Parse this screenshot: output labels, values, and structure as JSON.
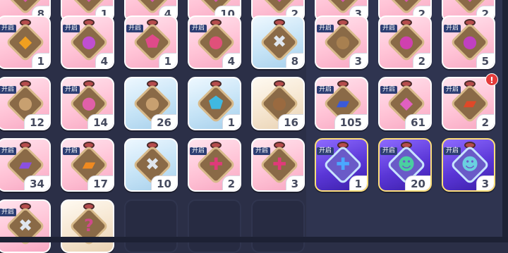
{
  "open_tag": "开启",
  "alert_glyph": "!",
  "rows": [
    [
      {
        "kind": "pink",
        "count": "8",
        "icon": "bag-icon",
        "glyph": "◆",
        "color": "#d45aa8",
        "tag": false
      },
      {
        "kind": "pink",
        "count": "1",
        "icon": "bag-icon",
        "glyph": "◆",
        "color": "#d45aa8",
        "tag": false
      },
      {
        "kind": "pink",
        "count": "4",
        "icon": "bag-icon",
        "glyph": "◆",
        "color": "#d45aa8",
        "tag": false
      },
      {
        "kind": "pink",
        "count": "10",
        "icon": "bag-icon",
        "glyph": "◆",
        "color": "#d45aa8",
        "tag": false
      },
      {
        "kind": "pink",
        "count": "2",
        "icon": "bag-icon",
        "glyph": "◆",
        "color": "#d45aa8",
        "tag": false
      },
      {
        "kind": "pink",
        "count": "3",
        "icon": "bag-icon",
        "glyph": "◆",
        "color": "#d45aa8",
        "tag": false
      },
      {
        "kind": "pink",
        "count": "2",
        "icon": "bag-icon",
        "glyph": "◆",
        "color": "#d45aa8",
        "tag": false
      },
      {
        "kind": "pink",
        "count": "2",
        "icon": "bag-icon",
        "glyph": "◆",
        "color": "#d45aa8",
        "tag": false
      }
    ],
    [
      {
        "kind": "pink",
        "count": "1",
        "icon": "gem-chest-icon",
        "glyph": "◆",
        "color": "#f0a020",
        "tag": true
      },
      {
        "kind": "pink",
        "count": "4",
        "icon": "pouch-icon",
        "glyph": "●",
        "color": "#c04fd0",
        "tag": true
      },
      {
        "kind": "pink",
        "count": "1",
        "icon": "gem-chest-icon",
        "glyph": "⬟",
        "color": "#e04a8a",
        "tag": true
      },
      {
        "kind": "pink",
        "count": "4",
        "icon": "pouch-icon",
        "glyph": "●",
        "color": "#e0507a",
        "tag": true
      },
      {
        "kind": "blue",
        "count": "8",
        "icon": "cross-chest-icon",
        "glyph": "✖",
        "color": "#dfe6ee",
        "tag": false
      },
      {
        "kind": "pink",
        "count": "3",
        "icon": "pouch-icon",
        "glyph": "●",
        "color": "#a88050",
        "tag": true
      },
      {
        "kind": "pink",
        "count": "2",
        "icon": "pouch-icon",
        "glyph": "●",
        "color": "#d040b0",
        "tag": true
      },
      {
        "kind": "pink",
        "count": "5",
        "icon": "pouch-icon",
        "glyph": "●",
        "color": "#c040c0",
        "tag": true
      }
    ],
    [
      {
        "kind": "pink",
        "count": "12",
        "icon": "pouch-icon",
        "glyph": "●",
        "color": "#c8a070",
        "tag": true
      },
      {
        "kind": "pink",
        "count": "14",
        "icon": "pouch-icon",
        "glyph": "●",
        "color": "#e060a8",
        "tag": true
      },
      {
        "kind": "blue",
        "count": "26",
        "icon": "pouch-icon",
        "glyph": "●",
        "color": "#c8a070",
        "tag": false
      },
      {
        "kind": "blue",
        "count": "1",
        "icon": "gem-chest-icon",
        "glyph": "⬟",
        "color": "#40b8e0",
        "tag": false
      },
      {
        "kind": "cream",
        "count": "16",
        "icon": "pouch-icon",
        "glyph": "●",
        "color": "#9a6a40",
        "tag": false
      },
      {
        "kind": "pink",
        "count": "105",
        "icon": "card-icon",
        "glyph": "▰",
        "color": "#3a5ad8",
        "tag": true
      },
      {
        "kind": "pink",
        "count": "61",
        "icon": "gem-chest-icon",
        "glyph": "◆",
        "color": "#e060c0",
        "tag": true
      },
      {
        "kind": "pink",
        "count": "2",
        "icon": "card-icon",
        "glyph": "▰",
        "color": "#e04828",
        "tag": true
      }
    ],
    [
      {
        "kind": "pink",
        "count": "34",
        "icon": "card-icon",
        "glyph": "▰",
        "color": "#8a50e0",
        "tag": true
      },
      {
        "kind": "pink",
        "count": "17",
        "icon": "card-icon",
        "glyph": "▰",
        "color": "#f08a20",
        "tag": true
      },
      {
        "kind": "blue",
        "count": "10",
        "icon": "cross-chest-icon",
        "glyph": "✖",
        "color": "#dfe6ee",
        "tag": false
      },
      {
        "kind": "pink",
        "count": "2",
        "icon": "cookie-icon",
        "glyph": "✚",
        "color": "#e03a7a",
        "tag": true
      },
      {
        "kind": "pink",
        "count": "3",
        "icon": "cookie-icon",
        "glyph": "✚",
        "color": "#e03a7a",
        "tag": true
      },
      {
        "kind": "purple",
        "count": "1",
        "icon": "cookie-icon",
        "glyph": "✚",
        "color": "#4aa8ff",
        "tag": true
      },
      {
        "kind": "purple",
        "count": "20",
        "icon": "cookie-icon",
        "glyph": "☻",
        "color": "#4ad0a0",
        "tag": true
      },
      {
        "kind": "purple",
        "count": "3",
        "icon": "cookie-icon",
        "glyph": "☻",
        "color": "#6ad0e0",
        "tag": true
      }
    ],
    [
      {
        "kind": "pink",
        "count": "",
        "icon": "cross-chest-icon",
        "glyph": "✖",
        "color": "#dfe6ee",
        "tag": true
      },
      {
        "kind": "cream",
        "count": "",
        "icon": "mystery-chest-icon",
        "glyph": "?",
        "color": "#d04a8a",
        "tag": false
      },
      {
        "kind": "empty"
      },
      {
        "kind": "empty"
      },
      {
        "kind": "empty"
      }
    ]
  ]
}
